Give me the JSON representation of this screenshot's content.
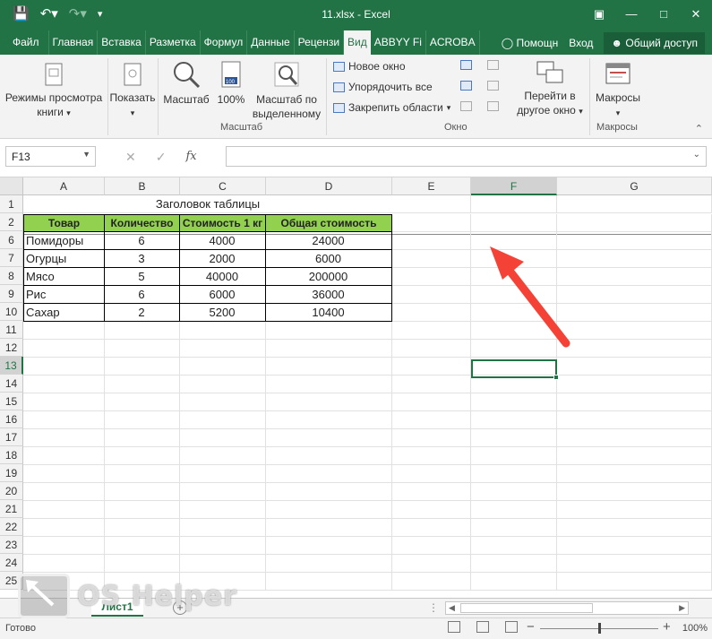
{
  "window": {
    "title": "11.xlsx - Excel",
    "accent": "#217346"
  },
  "tabs": {
    "file": "Файл",
    "home": "Главная",
    "insert": "Вставка",
    "layout": "Разметка",
    "formulas": "Формул",
    "data": "Данные",
    "review": "Рецензи",
    "view": "Вид",
    "abbyy": "ABBYY Fi",
    "acrobat": "ACROBA",
    "tell": "Помощн",
    "signin": "Вход",
    "share": "Общий доступ"
  },
  "ribbon": {
    "views_btn": "Режимы просмотра книги",
    "show_btn": "Показать",
    "zoom_btn": "Масштаб",
    "zoom100_btn": "100%",
    "zoom_sel_btn": "Масштаб по выделенному",
    "zoom_group": "Масштаб",
    "new_window": "Новое окно",
    "arrange_all": "Упорядочить все",
    "freeze_panes": "Закрепить области",
    "switch_windows": "Перейти в другое окно",
    "window_group": "Окно",
    "macros_btn": "Макросы",
    "macros_group": "Макросы"
  },
  "formula_bar": {
    "name_box": "F13",
    "fx": "fx",
    "content": ""
  },
  "columns": [
    "A",
    "B",
    "C",
    "D",
    "E",
    "F",
    "G"
  ],
  "selected_column": "F",
  "selected_row": "13",
  "sheet": {
    "title": "Заголовок таблицы",
    "headers": [
      "Товар",
      "Количество",
      "Стоимость 1 кг",
      "Общая стоимость"
    ],
    "rows": [
      {
        "row": "6",
        "cells": [
          "Помидоры",
          "6",
          "4000",
          "24000"
        ]
      },
      {
        "row": "7",
        "cells": [
          "Огурцы",
          "3",
          "2000",
          "6000"
        ]
      },
      {
        "row": "8",
        "cells": [
          "Мясо",
          "5",
          "40000",
          "200000"
        ]
      },
      {
        "row": "9",
        "cells": [
          "Рис",
          "6",
          "6000",
          "36000"
        ]
      },
      {
        "row": "10",
        "cells": [
          "Сахар",
          "2",
          "5200",
          "10400"
        ]
      }
    ],
    "row_numbers": [
      "1",
      "2",
      "6",
      "7",
      "8",
      "9",
      "10",
      "11",
      "12",
      "13",
      "14",
      "15",
      "16",
      "17",
      "18",
      "19",
      "20",
      "21",
      "22",
      "23",
      "24",
      "25"
    ],
    "header_fill": "#92d050"
  },
  "sheet_tabs": {
    "active": "Лист1"
  },
  "status": {
    "ready": "Готово",
    "zoom": "100%"
  },
  "watermark": {
    "text": "OS Helper"
  },
  "annotation": {
    "arrow_color": "#f44336"
  }
}
